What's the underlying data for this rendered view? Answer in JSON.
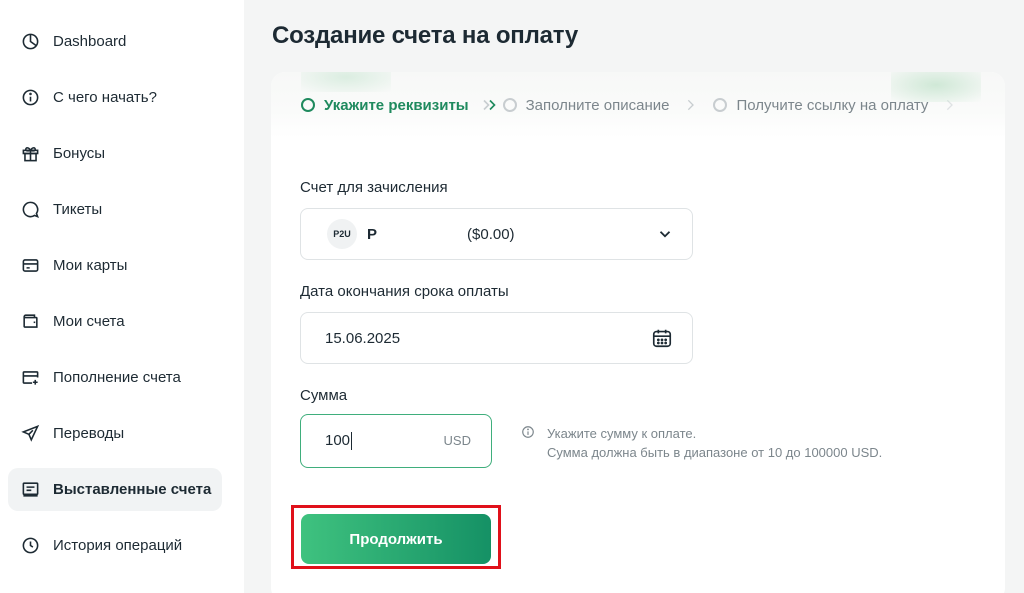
{
  "sidebar": {
    "items": [
      {
        "label": "Dashboard",
        "icon": "pie-chart-icon"
      },
      {
        "label": "С чего начать?",
        "icon": "info-icon"
      },
      {
        "label": "Бонусы",
        "icon": "gift-icon"
      },
      {
        "label": "Тикеты",
        "icon": "chat-bubble-icon"
      },
      {
        "label": "Мои карты",
        "icon": "card-icon"
      },
      {
        "label": "Мои счета",
        "icon": "wallet-icon"
      },
      {
        "label": "Пополнение счета",
        "icon": "card-add-icon"
      },
      {
        "label": "Переводы",
        "icon": "send-icon"
      },
      {
        "label": "Выставленные счета",
        "icon": "invoice-icon",
        "active": true
      },
      {
        "label": "История операций",
        "icon": "clock-icon"
      }
    ]
  },
  "page": {
    "title": "Создание счета на оплату"
  },
  "stepper": {
    "steps": [
      {
        "label": "Укажите реквизиты",
        "active": true
      },
      {
        "label": "Заполните описание",
        "active": false
      },
      {
        "label": "Получите ссылку на оплату",
        "active": false
      }
    ]
  },
  "form": {
    "account": {
      "label": "Счет для зачисления",
      "badge": "P2U",
      "name": "P",
      "balance": "($0.00)"
    },
    "due_date": {
      "label": "Дата окончания срока оплаты",
      "value": "15.06.2025"
    },
    "amount": {
      "label": "Сумма",
      "value": "100",
      "currency": "USD",
      "hint_line1": "Укажите сумму к оплате.",
      "hint_line2": "Сумма должна быть в диапазоне от 10 до 100000 USD."
    },
    "continue_label": "Продолжить"
  },
  "colors": {
    "accent": "#1f8a5e",
    "button_start": "#3fc27f",
    "button_end": "#159165",
    "highlight_frame": "#e0101a"
  }
}
